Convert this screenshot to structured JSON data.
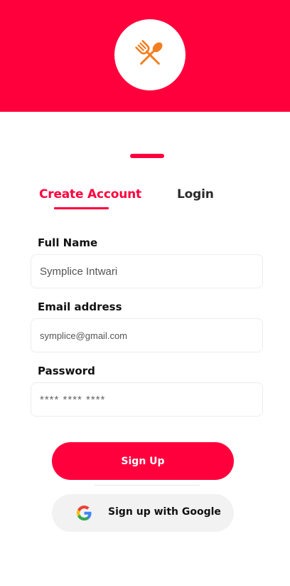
{
  "colors": {
    "accent": "#ff003d",
    "google_button_bg": "#f2f2f2"
  },
  "header": {
    "logo_icon": "fork-spoon-icon"
  },
  "tabs": [
    {
      "label": "Create Account",
      "active": true
    },
    {
      "label": "Login",
      "active": false
    }
  ],
  "form": {
    "full_name": {
      "label": "Full Name",
      "value": "Symplice Intwari"
    },
    "email": {
      "label": "Email address",
      "value": "symplice@gmail.com"
    },
    "password": {
      "label": "Password",
      "value": "**** **** ****"
    }
  },
  "buttons": {
    "signup_label": "Sign Up",
    "google_label": "Sign up with Google",
    "google_icon": "google-icon"
  }
}
